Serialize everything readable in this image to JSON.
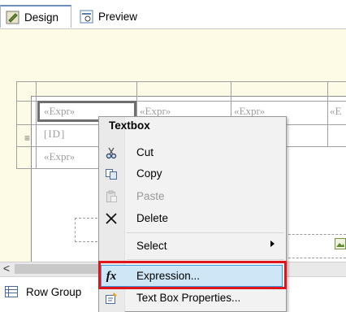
{
  "tabs": [
    {
      "label": "Design",
      "icon": "design-icon"
    },
    {
      "label": "Preview",
      "icon": "preview-icon"
    }
  ],
  "table": {
    "row1": [
      "«Expr»",
      "«Expr»",
      "«Expr»",
      "«E"
    ],
    "row2": [
      "[ID]"
    ],
    "row3": [
      "«Expr»"
    ],
    "handle": "≡"
  },
  "scrollbar": {
    "left_arrow": "<"
  },
  "bottom_panel": {
    "row_groups_label": "Row Group"
  },
  "context_menu": {
    "header": "Textbox",
    "items": [
      {
        "label": "Cut",
        "icon": "scissors-icon",
        "enabled": true
      },
      {
        "label": "Copy",
        "icon": "copy-icon",
        "enabled": true
      },
      {
        "label": "Paste",
        "icon": "paste-icon",
        "enabled": false
      },
      {
        "label": "Delete",
        "icon": "delete-x-icon",
        "enabled": true
      },
      {
        "label": "Select",
        "icon": "",
        "enabled": true,
        "submenu": true
      },
      {
        "label": "Expression...",
        "icon": "function-fx-icon",
        "enabled": true,
        "highlighted": true
      },
      {
        "label": "Text Box Properties...",
        "icon": "properties-icon",
        "enabled": true
      }
    ]
  },
  "colors": {
    "highlight": "#cde7f7",
    "highlight_border": "#3f9ae0",
    "annotation_red": "#e0151a",
    "surface": "#fdfbe6"
  }
}
